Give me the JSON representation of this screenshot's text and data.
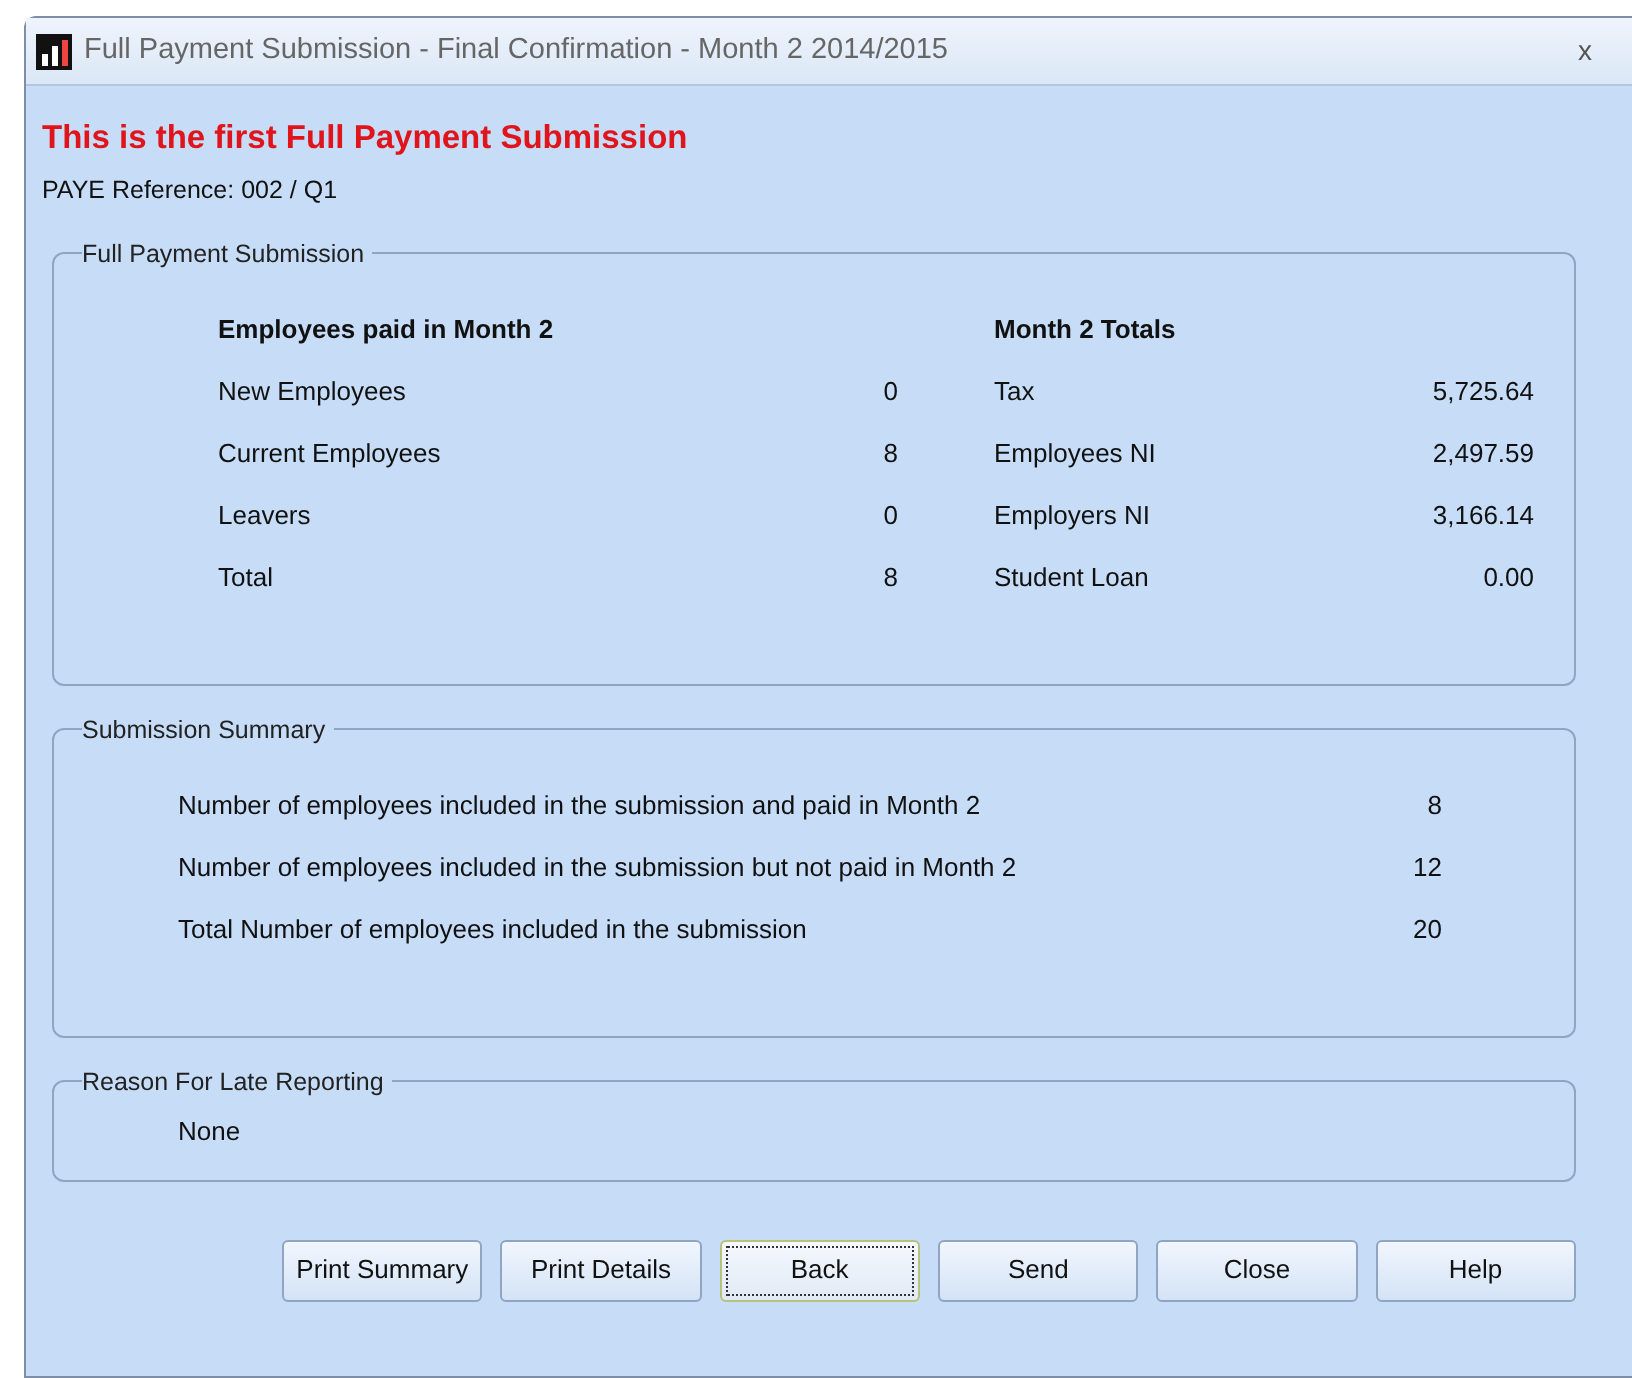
{
  "window": {
    "title": "Full Payment Submission - Final Confirmation - Month 2 2014/2015",
    "close": "x"
  },
  "heading": "This is the first Full Payment Submission",
  "paye_reference": "PAYE Reference: 002 / Q1",
  "full_payment_submission": {
    "legend": "Full Payment Submission",
    "employees": {
      "heading": "Employees paid in Month 2",
      "rows": [
        {
          "label": "New Employees",
          "value": "0"
        },
        {
          "label": "Current Employees",
          "value": "8"
        },
        {
          "label": "Leavers",
          "value": "0"
        },
        {
          "label": "Total",
          "value": "8"
        }
      ]
    },
    "totals": {
      "heading": "Month 2 Totals",
      "rows": [
        {
          "label": "Tax",
          "value": "5,725.64"
        },
        {
          "label": "Employees NI",
          "value": "2,497.59"
        },
        {
          "label": "Employers NI",
          "value": "3,166.14"
        },
        {
          "label": "Student Loan",
          "value": "0.00"
        }
      ]
    }
  },
  "submission_summary": {
    "legend": "Submission Summary",
    "rows": [
      {
        "label": "Number of employees included in the submission and paid in Month 2",
        "value": "8"
      },
      {
        "label": "Number of employees included in the submission but not paid in Month 2",
        "value": "12"
      },
      {
        "label": "Total Number of employees included in the submission",
        "value": "20"
      }
    ]
  },
  "late_reporting": {
    "legend": "Reason For Late Reporting",
    "value": "None"
  },
  "buttons": [
    {
      "label": "Print Summary",
      "focused": false
    },
    {
      "label": "Print Details",
      "focused": false
    },
    {
      "label": "Back",
      "focused": true
    },
    {
      "label": "Send",
      "focused": false
    },
    {
      "label": "Close",
      "focused": false
    },
    {
      "label": "Help",
      "focused": false
    }
  ]
}
